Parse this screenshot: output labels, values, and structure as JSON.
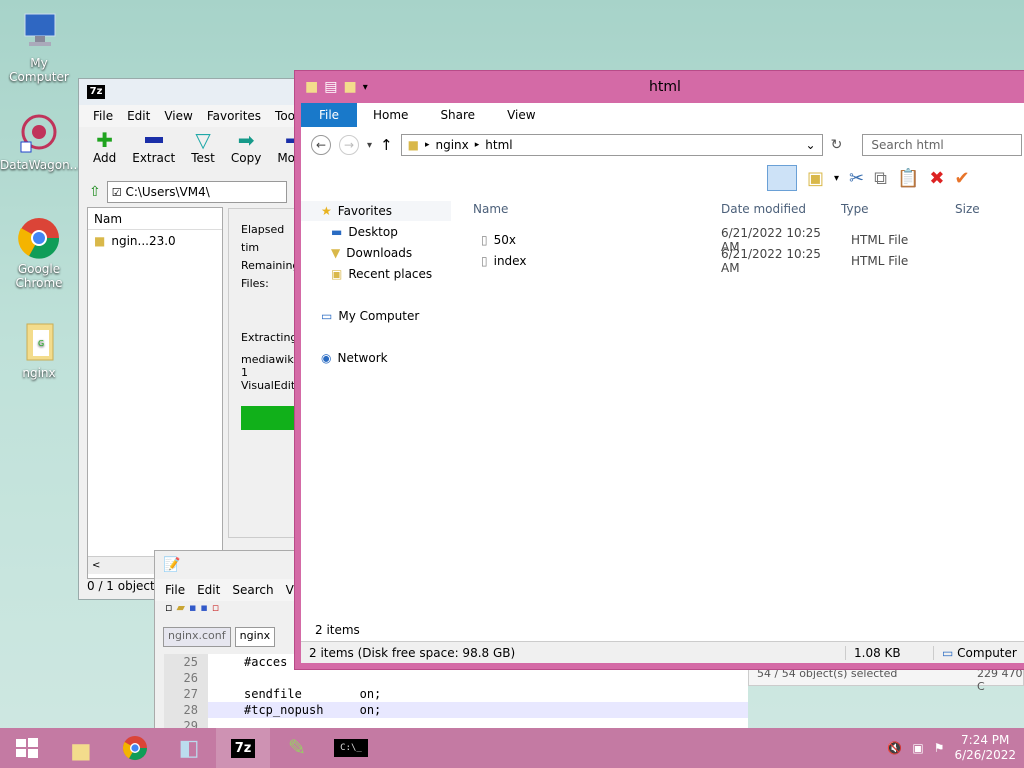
{
  "desktop": {
    "icons": [
      {
        "label": "My Computer"
      },
      {
        "label": "DataWagon..."
      },
      {
        "label": "Google Chrome"
      },
      {
        "label": "nginx"
      }
    ]
  },
  "sevenzip": {
    "logo": "7z",
    "menu": [
      "File",
      "Edit",
      "View",
      "Favorites",
      "Tools"
    ],
    "toolbar": [
      "Add",
      "Extract",
      "Test",
      "Copy",
      "Move"
    ],
    "path": "C:\\Users\\VM4\\",
    "list_header": "Nam",
    "list_item": "ngin...23.0",
    "status": "0 / 1 object(s"
  },
  "progress": {
    "elapsed": "Elapsed tim",
    "remaining": "Remaining",
    "files": "Files:",
    "extracting": "Extracting",
    "file_line1": "mediawiki-1",
    "file_line2": "VisualEdito",
    "fraction": 0.5
  },
  "notepad": {
    "menu": [
      "File",
      "Edit",
      "Search",
      "Vi"
    ],
    "tabs": [
      "nginx.conf",
      "nginx"
    ],
    "lines": [
      {
        "num": "25",
        "text": "#acces"
      },
      {
        "num": "26",
        "text": ""
      },
      {
        "num": "27",
        "text": "sendfile        on;"
      },
      {
        "num": "28",
        "text": "#tcp_nopush     on;"
      },
      {
        "num": "29",
        "text": ""
      }
    ]
  },
  "bg_window": {
    "left": "54 / 54 object(s) selected",
    "right": "229 470 C"
  },
  "explorer": {
    "title": "html",
    "ribbon": {
      "file": "File",
      "tabs": [
        "Home",
        "Share",
        "View"
      ]
    },
    "breadcrumb": [
      "nginx",
      "html"
    ],
    "search_placeholder": "Search html",
    "nav": {
      "favorites": "Favorites",
      "favorites_items": [
        "Desktop",
        "Downloads",
        "Recent places"
      ],
      "computer": "My Computer",
      "network": "Network"
    },
    "columns": {
      "name": "Name",
      "date": "Date modified",
      "type": "Type",
      "size": "Size"
    },
    "files": [
      {
        "name": "50x",
        "date": "6/21/2022 10:25 AM",
        "type": "HTML File"
      },
      {
        "name": "index",
        "date": "6/21/2022 10:25 AM",
        "type": "HTML File"
      }
    ],
    "count": "2 items",
    "status": {
      "left": "2 items (Disk free space: 98.8 GB)",
      "size": "1.08 KB",
      "location": "Computer"
    }
  },
  "taskbar": {
    "clock_time": "7:24 PM",
    "clock_date": "6/26/2022",
    "app_7z": "7z",
    "cmd": "C:\\_"
  },
  "colors": {
    "explorer_frame": "#d46aa6",
    "ribbon_file": "#1979ca",
    "taskbar": "#c47aa3"
  }
}
